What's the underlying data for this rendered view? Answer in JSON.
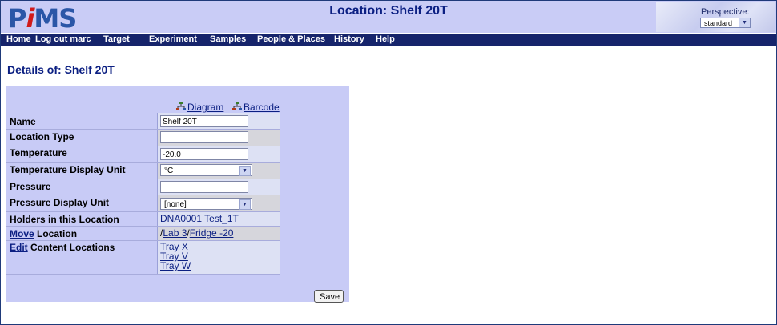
{
  "app": {
    "logo_prefix": "P",
    "logo_i": "i",
    "logo_suffix": "MS"
  },
  "header": {
    "title": "Location: Shelf 20T"
  },
  "perspective": {
    "label": "Perspective:",
    "selected": "standard"
  },
  "nav": {
    "items": [
      "Home",
      "Log out marc",
      "Target",
      "Experiment",
      "Samples",
      "People & Places",
      "History",
      "Help"
    ]
  },
  "details": {
    "title": "Details of: Shelf 20T",
    "diagram_link": "Diagram",
    "barcode_link": "Barcode",
    "labels": {
      "name": "Name",
      "location_type": "Location Type",
      "temperature": "Temperature",
      "temperature_unit": "Temperature Display Unit",
      "pressure": "Pressure",
      "pressure_unit": "Pressure Display Unit",
      "holders": "Holders in this Location",
      "move_link": "Move",
      "move_suffix": " Location",
      "edit_link": "Edit",
      "edit_suffix": " Content Locations"
    },
    "values": {
      "name": "Shelf 20T",
      "location_type": "",
      "temperature": "-20.0",
      "temperature_unit": "°C",
      "pressure": "",
      "pressure_unit": "[none]",
      "holder": "DNA0001 Test_1T",
      "path_sep": "/",
      "path": [
        "Lab 3",
        "Fridge -20"
      ],
      "contents": [
        "Tray X",
        "Tray V",
        "Tray W"
      ]
    },
    "save_label": "Save"
  },
  "colors": {
    "header_bg": "#c9ccf6",
    "nav_bg": "#16246b",
    "title_color": "#0b1f82",
    "panel_bg": "#c8cbf6"
  },
  "icons": {
    "diagram": "tree-icon",
    "barcode": "tree-icon"
  }
}
